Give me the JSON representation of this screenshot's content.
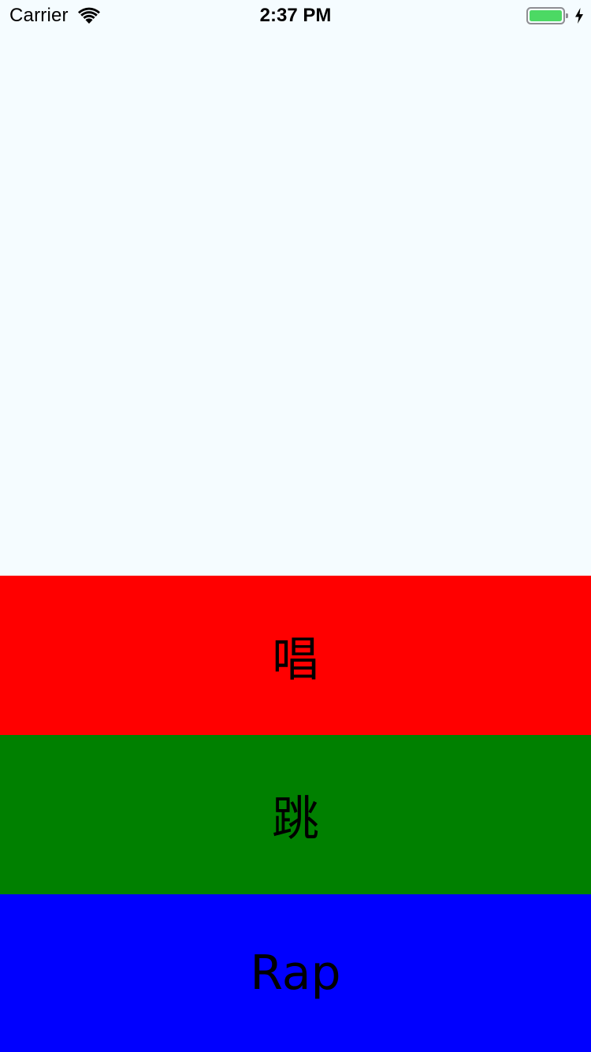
{
  "status_bar": {
    "carrier": "Carrier",
    "time": "2:37 PM",
    "icons": {
      "wifi": "wifi-icon",
      "battery": "battery-icon",
      "charging": "charging-icon"
    },
    "battery_color": "#4cd964"
  },
  "panels": [
    {
      "label": "唱",
      "color": "#ff0000"
    },
    {
      "label": "跳",
      "color": "#008000"
    },
    {
      "label": "Rap",
      "color": "#0000ff"
    }
  ],
  "background_color": "#f5fcff"
}
